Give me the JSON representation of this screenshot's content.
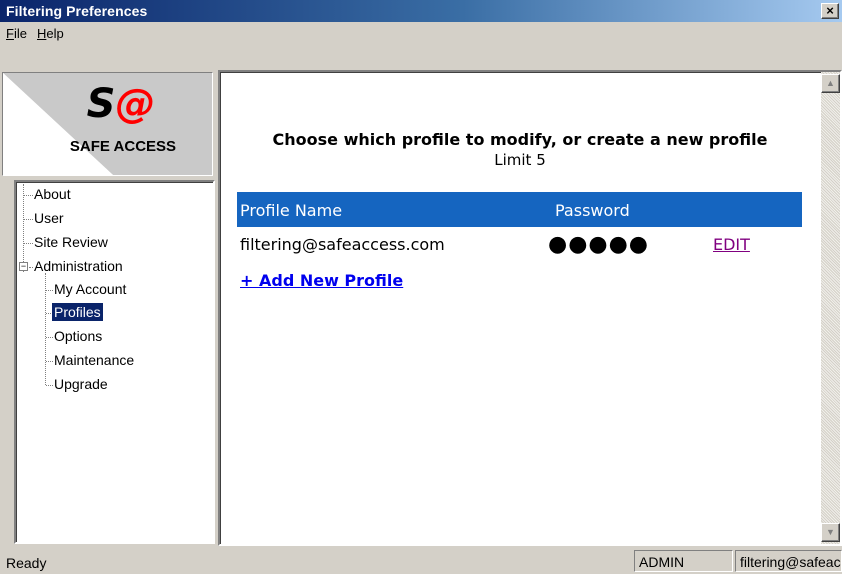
{
  "window": {
    "title": "Filtering Preferences",
    "close_glyph": "×"
  },
  "menu": [
    {
      "accel": "F",
      "rest": "ile"
    },
    {
      "accel": "H",
      "rest": "elp"
    }
  ],
  "logo": {
    "mark": "S@",
    "text": "SAFE ACCESS"
  },
  "tree": {
    "items": [
      "About",
      "User",
      "Site Review",
      "Administration",
      "My Account",
      "Profiles",
      "Options",
      "Maintenance",
      "Upgrade"
    ],
    "selected": "Profiles",
    "expander_glyph": "−"
  },
  "main": {
    "heading": "Choose which profile to modify, or create a new profile",
    "subheading": "Limit 5",
    "table": {
      "headers": [
        "Profile Name",
        "Password"
      ],
      "rows": [
        {
          "name": "filtering@safeaccess.com",
          "password": "●●●●●",
          "action": "EDIT"
        }
      ]
    },
    "add_link": "+ Add New Profile"
  },
  "scrollbar": {
    "up_glyph": "▲",
    "down_glyph": "▼"
  },
  "status": {
    "text": "Ready",
    "role": "ADMIN",
    "user": "filtering@safeaccess.com"
  },
  "colors": {
    "table_header": "#1565c0",
    "title_bar": "#0a246a",
    "logo_red": "#ff0000",
    "visited_link": "#800080",
    "link": "#0000ee"
  }
}
